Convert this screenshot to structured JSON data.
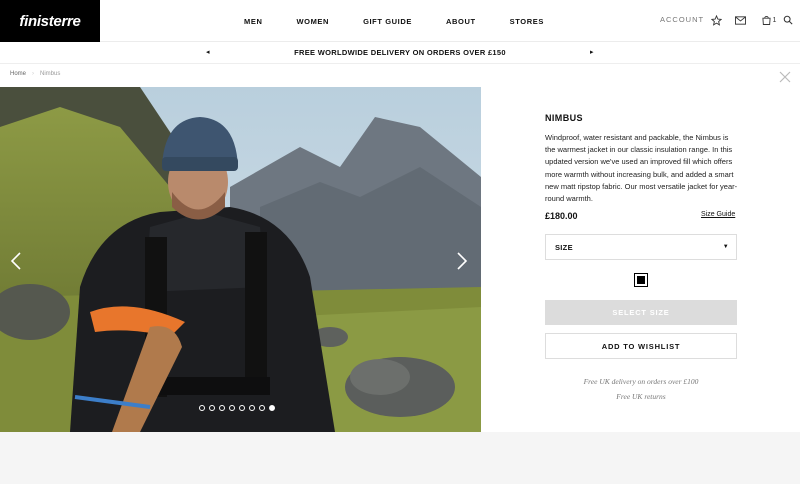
{
  "header": {
    "logo": "finisterre",
    "nav": [
      "MEN",
      "WOMEN",
      "GIFT GUIDE",
      "ABOUT",
      "STORES"
    ],
    "account_label": "ACCOUNT",
    "icons": [
      "star-icon",
      "mail-icon",
      "bag-icon",
      "search-icon"
    ],
    "bag_count": "1"
  },
  "promo": {
    "text": "FREE WORLDWIDE DELIVERY ON ORDERS OVER £150"
  },
  "breadcrumb": {
    "home": "Home",
    "current": "Nimbus"
  },
  "gallery": {
    "dot_count": 8,
    "active_index": 7
  },
  "product": {
    "name": "NIMBUS",
    "description": "Windproof, water resistant and packable, the Nimbus is the warmest jacket in our classic insulation range. In this updated version we've used an improved fill which offers more warmth without increasing bulk, and added a smart new matt ripstop fabric. Our most versatile jacket for year-round warmth.",
    "price": "£180.00",
    "size_guide": "Size Guide",
    "size_label": "SIZE",
    "colour": "#000000",
    "select_size_button": "SELECT SIZE",
    "wishlist_button": "ADD TO WISHLIST",
    "delivery_note": "Free UK delivery on orders over £100",
    "returns_note": "Free UK returns"
  }
}
